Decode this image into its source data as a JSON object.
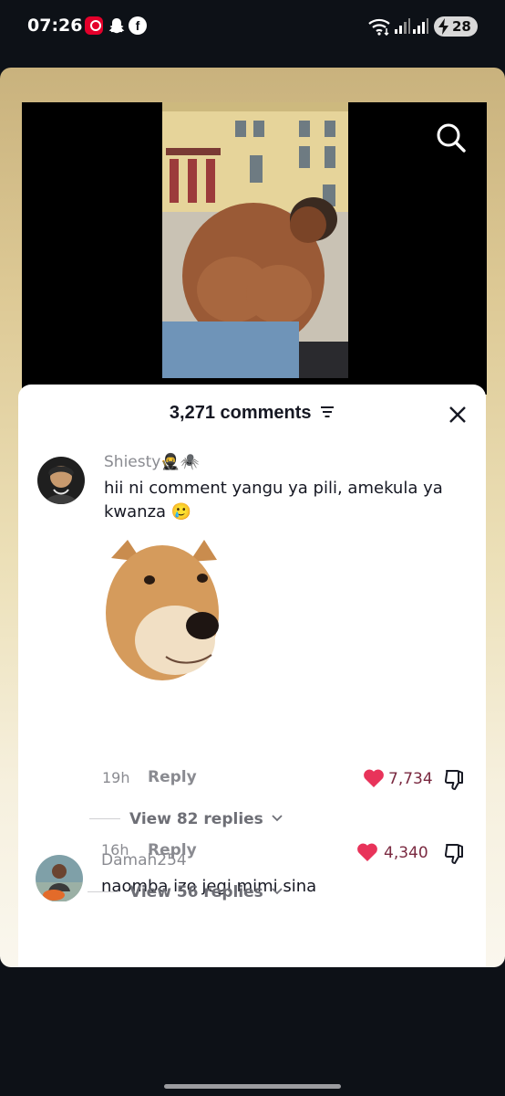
{
  "status_bar": {
    "time": "07:26",
    "battery": "28",
    "icons": [
      "airtel-icon",
      "snapchat-icon",
      "facebook-icon",
      "wifi-icon",
      "signal-icon",
      "signal-icon",
      "charging-icon"
    ]
  },
  "video": {
    "search_icon": "search-icon"
  },
  "comments": {
    "count_label": "3,271 comments",
    "items": [
      {
        "username": "Shiesty🥷🕷️",
        "text": "hii ni comment yangu ya pili, amekula ya kwanza",
        "emoji": "🥲",
        "time": "19h",
        "reply_label": "Reply",
        "likes": "7,734",
        "view_replies": "View 82 replies"
      },
      {
        "username": "Damah254",
        "text": "naomba izo jegi mimi sina",
        "time": "16h",
        "reply_label": "Reply",
        "likes": "4,340",
        "view_replies": "View 56 replies"
      }
    ]
  },
  "colors": {
    "like_heart": "#e8335a",
    "like_count": "#7a2940",
    "text_primary": "#161823",
    "text_secondary": "#8a8b91"
  }
}
